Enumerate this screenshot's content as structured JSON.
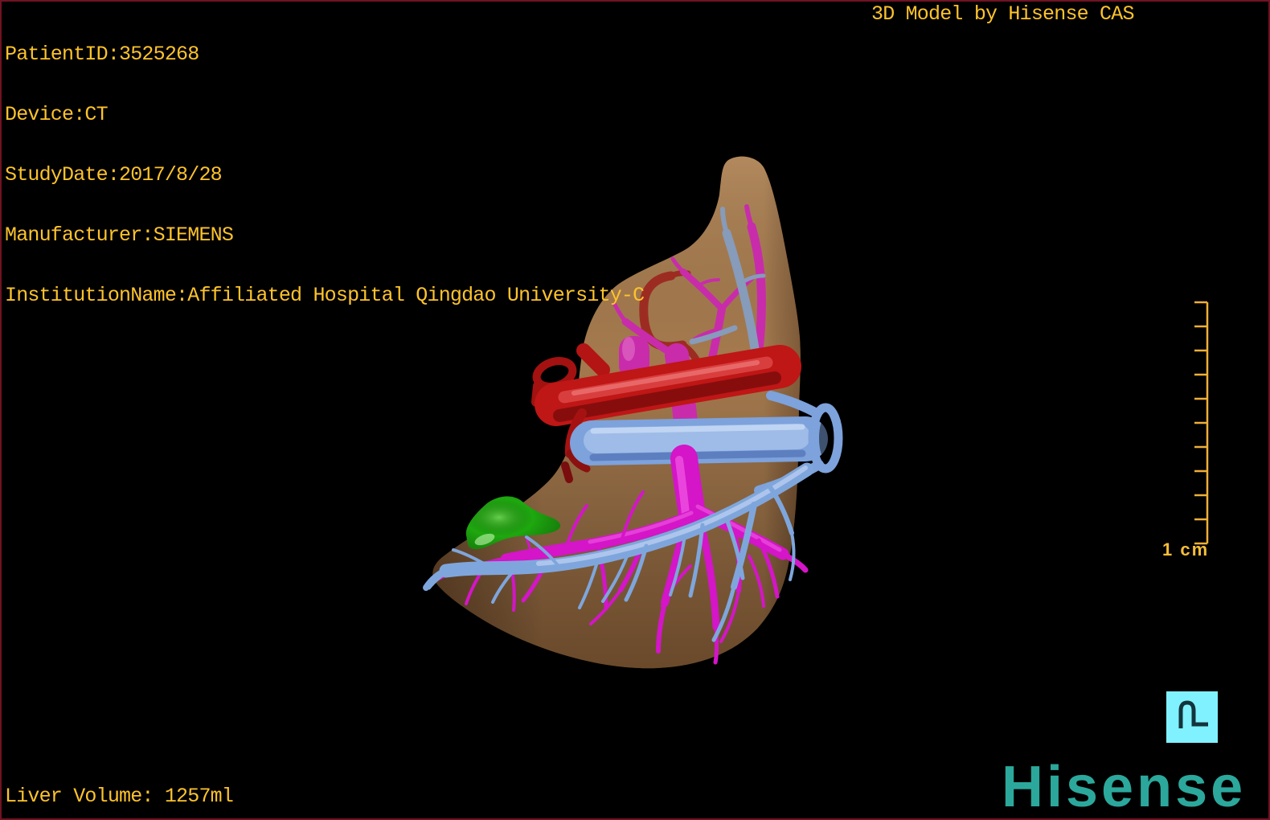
{
  "header": {
    "patient_info": [
      "PatientID:3525268",
      "Device:CT",
      "StudyDate:2017/8/28",
      "Manufacturer:SIEMENS",
      "InstitutionName:Affiliated Hospital Qingdao University-C"
    ],
    "watermark_title": "3D Model by Hisense CAS"
  },
  "viewport": {
    "structures": [
      "liver",
      "hepatic artery",
      "aorta",
      "portal vein",
      "hepatic veins",
      "inferior vena cava",
      "gallbladder"
    ]
  },
  "scale_bar": {
    "label": "1 cm",
    "tick_count": 11
  },
  "footer": {
    "liver_volume": "Liver Volume: 1257ml"
  },
  "branding": {
    "logo_text": "Hisense"
  },
  "colors": {
    "background": "#000000",
    "frame_border": "#701324",
    "overlay_text": "#fdc32c",
    "scale_bar": "#efaf38",
    "brand_teal": "#2ba89b",
    "orientation_icon_bg": "#80f2ff",
    "orientation_icon_glyph": "#13343c",
    "liver": "#a57a4e",
    "aorta": "#bf1616",
    "hepatic_artery": "#9a1414",
    "portal_vein": "#d415c8",
    "hepatic_vein": "#7fa6dc",
    "ivc": "#7da2dc",
    "gallbladder": "#1ea80f"
  }
}
